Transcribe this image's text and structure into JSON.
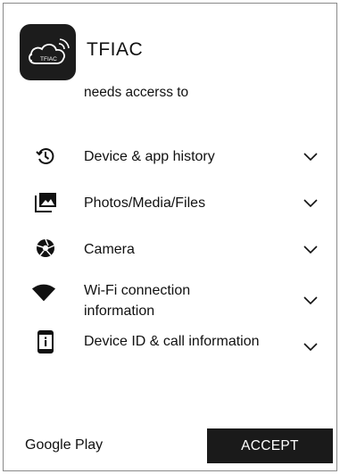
{
  "app": {
    "name": "TFIAC",
    "icon_text": "TFIAC",
    "icon": "cloud-wifi-logo-icon"
  },
  "header": {
    "subtitle": "needs accerss to"
  },
  "permissions": [
    {
      "icon": "history-icon",
      "label": "Device & app history"
    },
    {
      "icon": "photos-icon",
      "label": "Photos/Media/Files"
    },
    {
      "icon": "camera-aperture-icon",
      "label": "Camera"
    },
    {
      "icon": "wifi-icon",
      "label": "Wi-Fi connection information"
    },
    {
      "icon": "phone-info-icon",
      "label": "Device ID & call information"
    }
  ],
  "footer": {
    "brand": "Google Play",
    "accept_label": "ACCEPT"
  },
  "colors": {
    "background": "#ffffff",
    "text": "#111111",
    "button": "#1a1a1a",
    "button_text": "#ffffff",
    "border": "#8a8a8a"
  }
}
